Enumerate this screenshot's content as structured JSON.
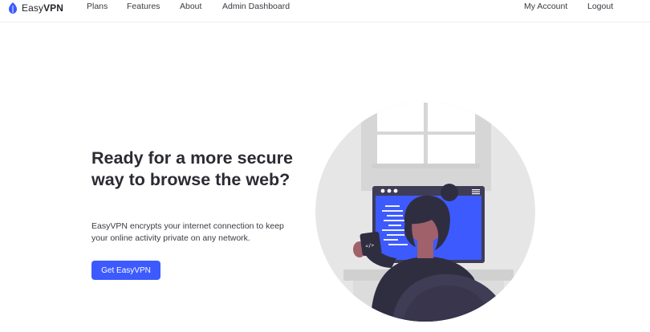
{
  "brand": {
    "name_prefix": "Easy",
    "name_suffix": "VPN"
  },
  "nav": {
    "plans": "Plans",
    "features": "Features",
    "about": "About",
    "admin": "Admin Dashboard",
    "account": "My Account",
    "logout": "Logout"
  },
  "hero": {
    "title": "Ready for a more secure way to browse the web?",
    "description": "EasyVPN encrypts your internet connection to keep your online activity private on any network.",
    "cta_label": "Get EasyVPN"
  },
  "colors": {
    "accent": "#3d5afe",
    "text": "#2b2b33",
    "illustration_bg": "#e6e6e6",
    "skin": "#a0616a",
    "hair": "#2f2e41"
  },
  "illustration": {
    "icon": "person-at-laptop-illustration",
    "mug_glyph": "</>"
  }
}
